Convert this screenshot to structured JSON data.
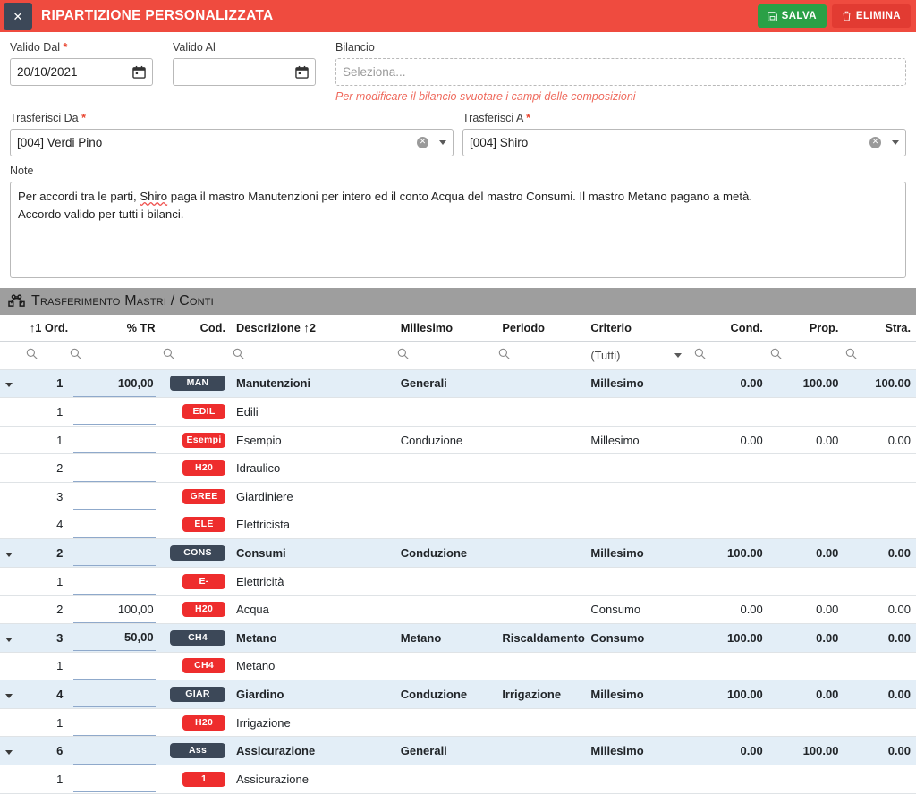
{
  "titlebar": {
    "close_label": "✕",
    "title": "RIPARTIZIONE PERSONALIZZATA",
    "save_label": "SALVA",
    "delete_label": "ELIMINA",
    "bg_color": "#ef4b3f",
    "save_color": "#2aa046",
    "delete_color": "#e23b32"
  },
  "form": {
    "valido_dal": {
      "label": "Valido Dal",
      "required": "*",
      "value": "20/10/2021"
    },
    "valido_al": {
      "label": "Valido Al",
      "required": "",
      "value": ""
    },
    "bilancio": {
      "label": "Bilancio",
      "placeholder": "Seleziona...",
      "hint": "Per modificare il bilancio svuotare i campi delle composizioni"
    },
    "trasferisci_da": {
      "label": "Trasferisci Da",
      "required": "*",
      "value": "[004] Verdi Pino"
    },
    "trasferisci_a": {
      "label": "Trasferisci A",
      "required": "*",
      "value": "[004] Shiro"
    },
    "note": {
      "label": "Note",
      "line1_a": "Per accordi tra le parti, ",
      "line1_b": "Shiro",
      "line1_c": " paga il mastro Manutenzioni per intero ed il conto Acqua del mastro Consumi. Il mastro Metano pagano a metà.",
      "line2": "Accordo valido per tutti i bilanci."
    }
  },
  "section": {
    "title": "Trasferimento Mastri / Conti",
    "icon": "vector-nodes-icon"
  },
  "table": {
    "columns": [
      {
        "key": "exp",
        "label": ""
      },
      {
        "key": "ord",
        "label": "↑1 Ord."
      },
      {
        "key": "tr",
        "label": "% TR"
      },
      {
        "key": "cod",
        "label": "Cod."
      },
      {
        "key": "desc",
        "label": "Descrizione ↑2"
      },
      {
        "key": "mill",
        "label": "Millesimo"
      },
      {
        "key": "per",
        "label": "Periodo"
      },
      {
        "key": "crit",
        "label": "Criterio"
      },
      {
        "key": "cond",
        "label": "Cond."
      },
      {
        "key": "prop",
        "label": "Prop."
      },
      {
        "key": "stra",
        "label": "Stra."
      }
    ],
    "filter_criterio": "(Tutti)",
    "rows": [
      {
        "type": "parent",
        "expander": true,
        "ord": "1",
        "tr": "100,00",
        "cod": "MAN",
        "desc": "Manutenzioni",
        "mill": "Generali",
        "per": "",
        "crit": "Millesimo",
        "cond": "0.00",
        "prop": "100.00",
        "stra": "100.00"
      },
      {
        "type": "child",
        "expander": false,
        "ord": "1",
        "tr": "",
        "cod": "EDIL",
        "desc": "Edili",
        "mill": "",
        "per": "",
        "crit": "",
        "cond": "",
        "prop": "",
        "stra": ""
      },
      {
        "type": "child",
        "expander": false,
        "ord": "1",
        "tr": "",
        "cod": "Esempi",
        "desc": "Esempio",
        "mill": "Conduzione",
        "per": "",
        "crit": "Millesimo",
        "cond": "0.00",
        "prop": "0.00",
        "stra": "0.00"
      },
      {
        "type": "child",
        "expander": false,
        "ord": "2",
        "tr": "",
        "cod": "H20",
        "desc": "Idraulico",
        "mill": "",
        "per": "",
        "crit": "",
        "cond": "",
        "prop": "",
        "stra": ""
      },
      {
        "type": "child",
        "expander": false,
        "ord": "3",
        "tr": "",
        "cod": "GREE",
        "desc": "Giardiniere",
        "mill": "",
        "per": "",
        "crit": "",
        "cond": "",
        "prop": "",
        "stra": ""
      },
      {
        "type": "child",
        "expander": false,
        "ord": "4",
        "tr": "",
        "cod": "ELE",
        "desc": "Elettricista",
        "mill": "",
        "per": "",
        "crit": "",
        "cond": "",
        "prop": "",
        "stra": ""
      },
      {
        "type": "parent",
        "expander": true,
        "ord": "2",
        "tr": "",
        "cod": "CONS",
        "desc": "Consumi",
        "mill": "Conduzione",
        "per": "",
        "crit": "Millesimo",
        "cond": "100.00",
        "prop": "0.00",
        "stra": "0.00"
      },
      {
        "type": "child",
        "expander": false,
        "ord": "1",
        "tr": "",
        "cod": "E-",
        "desc": "Elettricità",
        "mill": "",
        "per": "",
        "crit": "",
        "cond": "",
        "prop": "",
        "stra": ""
      },
      {
        "type": "child",
        "expander": false,
        "ord": "2",
        "tr": "100,00",
        "cod": "H20",
        "desc": "Acqua",
        "mill": "",
        "per": "",
        "crit": "Consumo",
        "cond": "0.00",
        "prop": "0.00",
        "stra": "0.00"
      },
      {
        "type": "parent",
        "expander": true,
        "ord": "3",
        "tr": "50,00",
        "cod": "CH4",
        "desc": "Metano",
        "mill": "Metano",
        "per": "Riscaldamento",
        "crit": "Consumo",
        "cond": "100.00",
        "prop": "0.00",
        "stra": "0.00"
      },
      {
        "type": "child",
        "expander": false,
        "ord": "1",
        "tr": "",
        "cod": "CH4",
        "desc": "Metano",
        "mill": "",
        "per": "",
        "crit": "",
        "cond": "",
        "prop": "",
        "stra": ""
      },
      {
        "type": "parent",
        "expander": true,
        "ord": "4",
        "tr": "",
        "cod": "GIAR",
        "desc": "Giardino",
        "mill": "Conduzione",
        "per": "Irrigazione",
        "crit": "Millesimo",
        "cond": "100.00",
        "prop": "0.00",
        "stra": "0.00"
      },
      {
        "type": "child",
        "expander": false,
        "ord": "1",
        "tr": "",
        "cod": "H20",
        "desc": "Irrigazione",
        "mill": "",
        "per": "",
        "crit": "",
        "cond": "",
        "prop": "",
        "stra": ""
      },
      {
        "type": "parent",
        "expander": true,
        "ord": "6",
        "tr": "",
        "cod": "Ass",
        "desc": "Assicurazione",
        "mill": "Generali",
        "per": "",
        "crit": "Millesimo",
        "cond": "0.00",
        "prop": "100.00",
        "stra": "0.00"
      },
      {
        "type": "child",
        "expander": false,
        "ord": "1",
        "tr": "",
        "cod": "1",
        "desc": "Assicurazione",
        "mill": "",
        "per": "",
        "crit": "",
        "cond": "",
        "prop": "",
        "stra": ""
      }
    ]
  }
}
